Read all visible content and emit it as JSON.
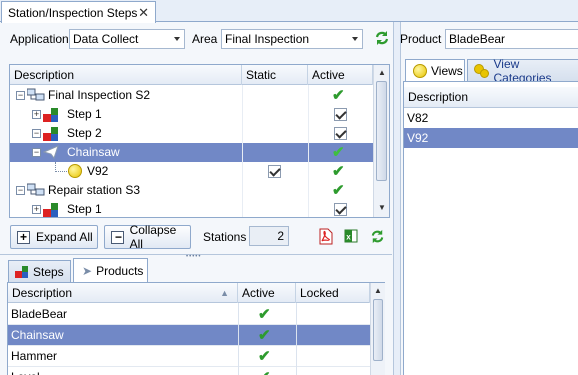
{
  "window": {
    "tab_title": "Station/Inspection Steps"
  },
  "filters": {
    "application_label": "Application",
    "application_value": "Data Collect",
    "area_label": "Area",
    "area_value": "Final Inspection",
    "product_label": "Product",
    "product_value": "BladeBear"
  },
  "steps_grid": {
    "columns": [
      "Description",
      "Static",
      "Active"
    ],
    "rows": [
      {
        "label": "Final Inspection S2",
        "level": 0,
        "static": false,
        "active": "tick"
      },
      {
        "label": "Step 1",
        "level": 1,
        "static": false,
        "active": "check"
      },
      {
        "label": "Step 2",
        "level": 1,
        "static": false,
        "active": "check"
      },
      {
        "label": "Chainsaw",
        "level": 2,
        "static": false,
        "active": "tick",
        "selected": true
      },
      {
        "label": "V92",
        "level": 3,
        "static": true,
        "active": "tick"
      },
      {
        "label": "Repair station S3",
        "level": 0,
        "static": false,
        "active": "tick"
      },
      {
        "label": "Step 1",
        "level": 1,
        "static": false,
        "active": "check"
      }
    ]
  },
  "actions": {
    "expand_all": "Expand All",
    "collapse_all": "Collapse All",
    "stations_label": "Stations",
    "stations_value": "2"
  },
  "bottom_tabs": {
    "steps": "Steps",
    "products": "Products"
  },
  "products_grid": {
    "columns": [
      "Description",
      "Active",
      "Locked"
    ],
    "rows": [
      {
        "label": "BladeBear",
        "active": true,
        "selected": false
      },
      {
        "label": "Chainsaw",
        "active": true,
        "selected": true
      },
      {
        "label": "Hammer",
        "active": true,
        "selected": false
      },
      {
        "label": "Level",
        "active": true,
        "selected": false
      }
    ]
  },
  "right_panel": {
    "tabs": [
      "Views",
      "View Categories"
    ],
    "column": "Description",
    "rows": [
      {
        "label": "V82",
        "selected": false
      },
      {
        "label": "V92",
        "selected": true
      }
    ]
  },
  "colors": {
    "selection": "#7188c6",
    "accent_border": "#8fa9cc",
    "check_green": "#2e9b2e"
  }
}
